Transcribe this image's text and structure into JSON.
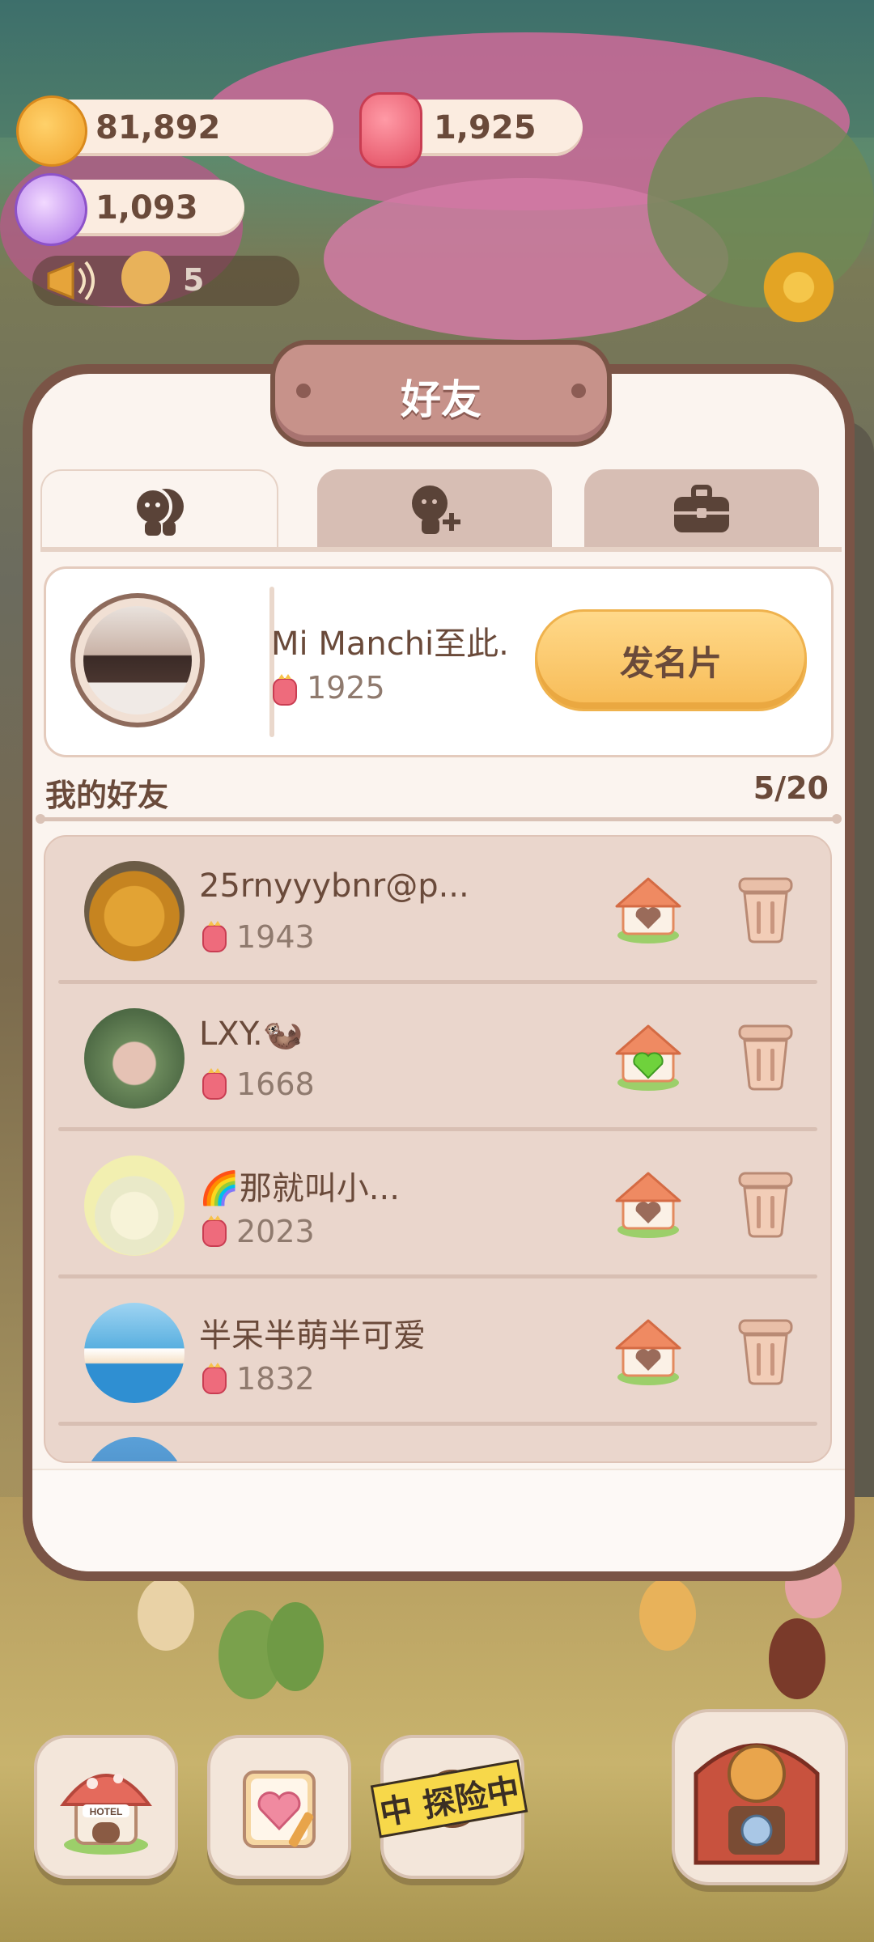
{
  "currency": {
    "cookies": "81,892",
    "gems": "1,925",
    "crystals": "1,093"
  },
  "notice": {
    "count": "5"
  },
  "panel": {
    "title": "好友",
    "tabs": [
      {
        "icon": "friends-icon",
        "active": true
      },
      {
        "icon": "add-friend-icon",
        "active": false
      },
      {
        "icon": "briefcase-icon",
        "active": false
      }
    ]
  },
  "profile": {
    "name": "Mi Manchi至此.",
    "score": "1925",
    "card_button": "发名片"
  },
  "friends_section": {
    "title": "我的好友",
    "count": "5/20"
  },
  "friends": [
    {
      "name": "25rnyyybnr@p...",
      "score": "1943",
      "house_icon": "house-heart-icon"
    },
    {
      "name": "LXY.🦦",
      "score": "1668",
      "house_icon": "house-heart-green-icon"
    },
    {
      "name": "🌈那就叫小...",
      "score": "2023",
      "house_icon": "house-heart-icon"
    },
    {
      "name": "半呆半萌半可爱",
      "score": "1832",
      "house_icon": "house-heart-icon"
    }
  ],
  "bottom_nav": {
    "hotel_label": "HOTEL",
    "expedition_label": "中 探险中"
  },
  "colors": {
    "panel_border": "#7a5446",
    "panel_bg": "#fbf4ef",
    "list_bg": "#ead6cc",
    "button_yellow": "#f7bb56",
    "text_brown": "#6a4a3a"
  }
}
